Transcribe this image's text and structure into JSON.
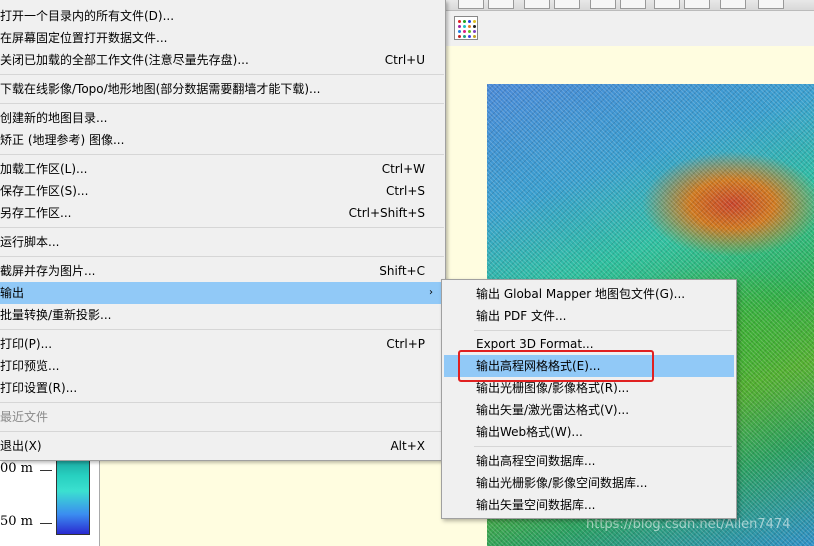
{
  "legend": {
    "label_top": "00 m",
    "label_bottom": "50 m"
  },
  "watermark": "https://blog.csdn.net/Allen7474",
  "main_menu": {
    "open_dir": "打开一个目录内的所有文件(D)...",
    "open_fixed": "在屏幕固定位置打开数据文件...",
    "close_all": {
      "label": "关闭已加载的全部工作文件(注意尽量先存盘)...",
      "shortcut": "Ctrl+U"
    },
    "download_online": "下载在线影像/Topo/地形地图(部分数据需要翻墙才能下载)...",
    "create_catalog": "创建新的地图目录...",
    "rectify": "矫正 (地理参考) 图像...",
    "load_workspace": {
      "label": "加载工作区(L)...",
      "shortcut": "Ctrl+W"
    },
    "save_workspace": {
      "label": "保存工作区(S)...",
      "shortcut": "Ctrl+S"
    },
    "save_workspace_as": {
      "label": "另存工作区...",
      "shortcut": "Ctrl+Shift+S"
    },
    "run_script": "运行脚本...",
    "screenshot": {
      "label": "截屏并存为图片...",
      "shortcut": "Shift+C"
    },
    "export": {
      "label": "输出",
      "arrow": "›"
    },
    "batch_convert": "批量转换/重新投影...",
    "print": {
      "label": "打印(P)...",
      "shortcut": "Ctrl+P"
    },
    "print_preview": "打印预览...",
    "print_setup": "打印设置(R)...",
    "recent_files": "最近文件",
    "exit": {
      "label": "退出(X)",
      "shortcut": "Alt+X"
    }
  },
  "export_submenu": {
    "gm_package": "输出 Global Mapper 地图包文件(G)...",
    "pdf": "输出 PDF 文件...",
    "export_3d": "Export 3D Format...",
    "elevation_grid": "输出高程网格格式(E)...",
    "raster_image": "输出光栅图像/影像格式(R)...",
    "vector_lidar": "输出矢量/激光雷达格式(V)...",
    "web": "输出Web格式(W)...",
    "elev_db": "输出高程空间数据库...",
    "raster_db": "输出光栅影像/影像空间数据库...",
    "vector_db": "输出矢量空间数据库..."
  },
  "colors": {
    "highlight": "#91c9f7",
    "annotation_box": "#e02020",
    "menu_bg": "#f0f0f0"
  }
}
